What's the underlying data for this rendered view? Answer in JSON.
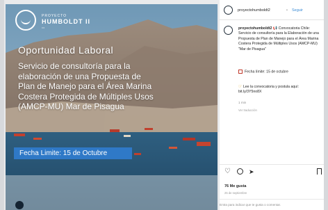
{
  "post_image": {
    "logo": {
      "small_text": "PROYECTO",
      "big_text": "HUMBOLDT II",
      "sub_text": "•••"
    },
    "headline": "Oportunidad Laboral",
    "description": "Servicio de consultoría para la elaboración de una Propuesta de Plan de Manejo para el Área Marina Costera Protegida de Múltiples Usos (AMCP-MU) Mar de Pisagua",
    "deadline": "Fecha Limite: 15 de Octubre"
  },
  "header": {
    "username": "proyectohumboldt2",
    "separator": "•",
    "follow_label": "Seguir"
  },
  "caption": {
    "username": "proyectohumboldt2",
    "text": "📢 Convocatoria Chile: Servicio de consultoría para la Elaboración de una Propuesta de Plan de Manejo para el Área Marina Costera Protegida de Múltiples Usos (AMCP-MU) \"Mar de Pisagua\"",
    "deadline_line": "Fecha límite: 15 de octubre",
    "link_line": "Lee la convocatoria y postula aquí: bit.ly/3Y5no8X",
    "time": "1 min",
    "view_translation": "Ver traducción"
  },
  "actions": {
    "likes": "76 Me gusta",
    "date": "25 de septiembre"
  },
  "comment_box": {
    "placeholder": "Entra para indicar que te gusta o comentar."
  },
  "colors": {
    "accent_blue": "#2f79c7",
    "follow_blue": "#3b8cd6"
  }
}
